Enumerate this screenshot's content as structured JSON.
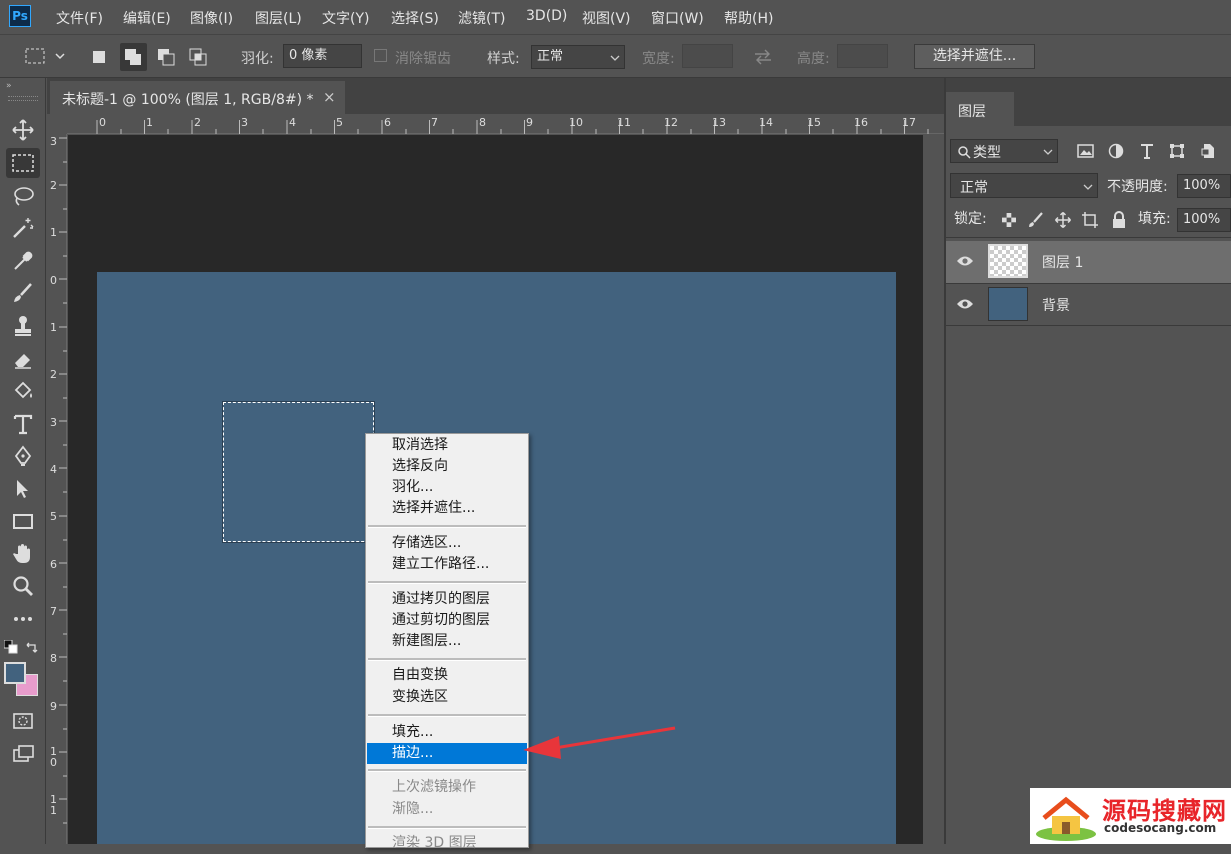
{
  "app": {
    "logo": "Ps"
  },
  "menu": [
    "文件(F)",
    "编辑(E)",
    "图像(I)",
    "图层(L)",
    "文字(Y)",
    "选择(S)",
    "滤镜(T)",
    "3D(D)",
    "视图(V)",
    "窗口(W)",
    "帮助(H)"
  ],
  "options": {
    "feather_label": "羽化:",
    "feather_value": "0 像素",
    "antialias_label": "消除锯齿",
    "style_label": "样式:",
    "style_value": "正常",
    "width_label": "宽度:",
    "height_label": "高度:",
    "select_mask_button": "选择并遮住..."
  },
  "document": {
    "tab_title": "未标题-1 @ 100% (图层 1, RGB/8#) *",
    "close_glyph": "×",
    "ruler_top": [
      "0",
      "1",
      "2",
      "3",
      "4",
      "5",
      "6",
      "7",
      "8",
      "9",
      "10",
      "11",
      "12",
      "13",
      "14",
      "15",
      "16",
      "17"
    ],
    "ruler_left": [
      "3",
      "2",
      "1",
      "0",
      "1",
      "2",
      "3",
      "4",
      "5",
      "6",
      "7",
      "8",
      "9",
      "10",
      "11"
    ]
  },
  "context_menu": {
    "group1": [
      "取消选择",
      "选择反向",
      "羽化...",
      "选择并遮住..."
    ],
    "group2": [
      "存储选区...",
      "建立工作路径..."
    ],
    "group3": [
      "通过拷贝的图层",
      "通过剪切的图层",
      "新建图层..."
    ],
    "group4": [
      "自由变换",
      "变换选区"
    ],
    "group5": [
      "填充...",
      "描边..."
    ],
    "group6": [
      "上次滤镜操作",
      "渐隐..."
    ],
    "group7": [
      "渲染 3D 图层"
    ]
  },
  "layers_panel": {
    "tab": "图层",
    "filter_kind": "类型",
    "blend_mode": "正常",
    "opacity_label": "不透明度:",
    "opacity_value": "100%",
    "lock_label": "锁定:",
    "fill_label": "填充:",
    "fill_value": "100%",
    "layers": [
      {
        "name": "图层 1",
        "selected": true
      },
      {
        "name": "背景",
        "selected": false
      }
    ]
  },
  "colors": {
    "canvas": "#42627e",
    "foreground": "#42627e",
    "background_swatch": "#e89ccc",
    "highlight": "#0078d7",
    "arrow": "#e8353a"
  },
  "watermark": {
    "title": "源码搜藏网",
    "url": "codesocang.com"
  }
}
